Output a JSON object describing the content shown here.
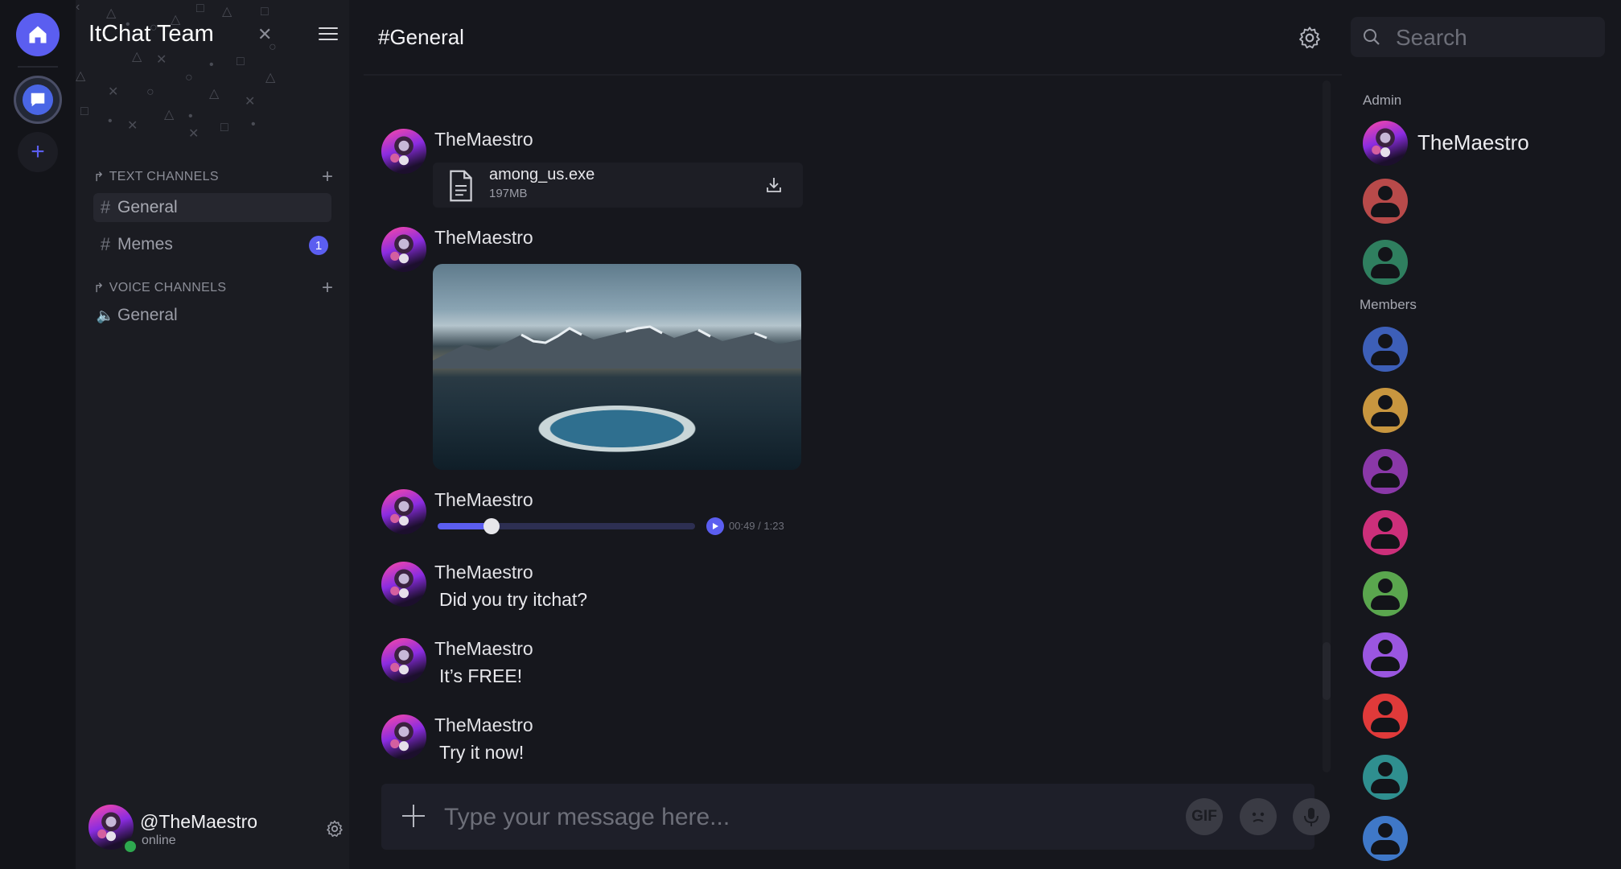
{
  "server_rail": {
    "icons": [
      "home-icon",
      "chat-bubble-icon",
      "plus-icon"
    ],
    "accent": "#5b5ef0"
  },
  "sidebar": {
    "team_name": "ItChat Team",
    "text_channels_label": "TEXT CHANNELS",
    "voice_channels_label": "VOICE CHANNELS",
    "text_channels": [
      {
        "name": "General",
        "active": true
      },
      {
        "name": "Memes",
        "unread": "1"
      }
    ],
    "voice_channels": [
      {
        "name": "General"
      }
    ]
  },
  "user_panel": {
    "username": "@TheMaestro",
    "status": "online",
    "status_color": "#2ea84f"
  },
  "channel": {
    "title": "#General"
  },
  "messages": [
    {
      "author": "TheMaestro",
      "type": "file",
      "file_name": "among_us.exe",
      "file_size": "197MB"
    },
    {
      "author": "TheMaestro",
      "type": "image"
    },
    {
      "author": "TheMaestro",
      "type": "audio",
      "time": "00:49 / 1:23",
      "progress": 0.21
    },
    {
      "author": "TheMaestro",
      "type": "text",
      "text": "Did you try itchat?"
    },
    {
      "author": "TheMaestro",
      "type": "text",
      "text": "It’s FREE!"
    },
    {
      "author": "TheMaestro",
      "type": "text",
      "text": "Try it now!"
    }
  ],
  "composer": {
    "placeholder": "Type your message here...",
    "gif_label": "GIF"
  },
  "members_panel": {
    "search_placeholder": "Search",
    "admin_label": "Admin",
    "members_label": "Members",
    "admin_name": "TheMaestro",
    "admin_colors": [
      "#b84a4a",
      "#2f7f5f"
    ],
    "member_colors": [
      "#3d5fb8",
      "#c8963f",
      "#8a38a8",
      "#cc2f7a",
      "#5aa64e",
      "#9a56e0",
      "#e03a3a",
      "#2f8f8f",
      "#3f78c8"
    ]
  }
}
